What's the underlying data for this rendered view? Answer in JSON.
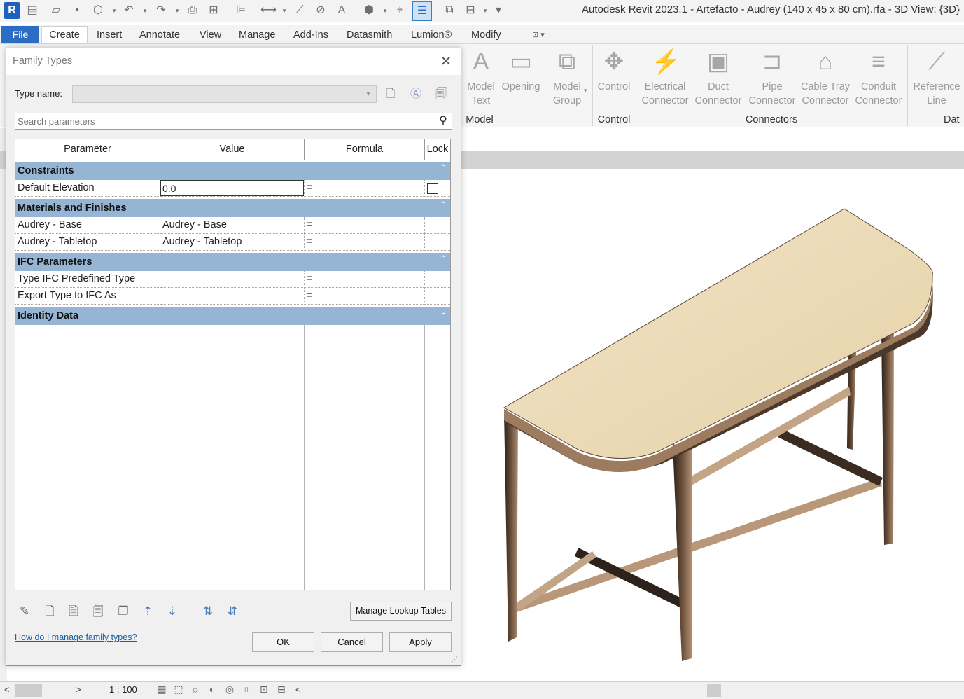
{
  "app": {
    "logo_letter": "R",
    "window_title": "Autodesk Revit 2023.1 - Artefacto - Audrey (140 x 45 x 80 cm).rfa - 3D View: {3D}"
  },
  "qat": {
    "icons": [
      "open-icon",
      "save-icon",
      "sync-icon",
      "undo-icon",
      "redo-icon",
      "print-icon",
      "align-icon",
      "measure-icon",
      "text-icon",
      "default-3d-icon",
      "thin-lines-icon",
      "switch-windows-icon"
    ],
    "text_tool_glyph": "A"
  },
  "ribbon_tabs": [
    "File",
    "Create",
    "Insert",
    "Annotate",
    "View",
    "Manage",
    "Add-Ins",
    "Datasmith",
    "Lumion®",
    "Modify"
  ],
  "ribbon": {
    "buttons": [
      {
        "label": "Model\nText",
        "icon": "model-text-icon",
        "glyph": "A"
      },
      {
        "label": "Opening",
        "icon": "opening-icon",
        "glyph": "▭"
      },
      {
        "label": "Model\nGroup",
        "icon": "model-group-icon",
        "glyph": "⧉"
      },
      {
        "label": "Control",
        "icon": "control-icon",
        "glyph": "✥"
      },
      {
        "label": "Electrical\nConnector",
        "icon": "electrical-connector-icon",
        "glyph": "⚡"
      },
      {
        "label": "Duct\nConnector",
        "icon": "duct-connector-icon",
        "glyph": "▣"
      },
      {
        "label": "Pipe\nConnector",
        "icon": "pipe-connector-icon",
        "glyph": "⊐"
      },
      {
        "label": "Cable Tray\nConnector",
        "icon": "cable-tray-connector-icon",
        "glyph": "⌂"
      },
      {
        "label": "Conduit\nConnector",
        "icon": "conduit-connector-icon",
        "glyph": "≡"
      },
      {
        "label": "Reference\nLine",
        "icon": "reference-line-icon",
        "glyph": "⟋"
      }
    ],
    "panels": [
      "Model",
      "Control",
      "Connectors",
      "Dat"
    ]
  },
  "dialog": {
    "title": "Family Types",
    "type_name_label": "Type name:",
    "type_name_value": "",
    "search_placeholder": "Search parameters",
    "columns": [
      "Parameter",
      "Value",
      "Formula",
      "Lock"
    ],
    "groups": [
      {
        "name": "Constraints",
        "expanded": true,
        "rows": [
          {
            "parameter": "Default Elevation",
            "value": "0.0",
            "formula": "=",
            "lock": false
          }
        ]
      },
      {
        "name": "Materials and Finishes",
        "expanded": true,
        "rows": [
          {
            "parameter": "Audrey - Base",
            "value": "Audrey - Base",
            "formula": "="
          },
          {
            "parameter": "Audrey - Tabletop",
            "value": "Audrey - Tabletop",
            "formula": "="
          }
        ]
      },
      {
        "name": "IFC Parameters",
        "expanded": true,
        "rows": [
          {
            "parameter": "Type IFC Predefined Type",
            "value": "",
            "formula": "="
          },
          {
            "parameter": "Export Type to IFC As",
            "value": "",
            "formula": "="
          }
        ]
      },
      {
        "name": "Identity Data",
        "expanded": false,
        "rows": []
      }
    ],
    "toggle_collapse": "⌃",
    "toggle_expand": "⌄",
    "manage_lookup_label": "Manage Lookup Tables",
    "help_link": "How do I manage family types?",
    "ok_label": "OK",
    "cancel_label": "Cancel",
    "apply_label": "Apply",
    "close_glyph": "✕"
  },
  "status_bar": {
    "scale": "1 : 100",
    "left_arrow": "<",
    "right_arrow": ">"
  },
  "colors": {
    "group_header": "#96b4d3",
    "file_tab": "#2b6cc4",
    "tabletop": "#eddcb7",
    "legs": "#6b4f3a"
  }
}
